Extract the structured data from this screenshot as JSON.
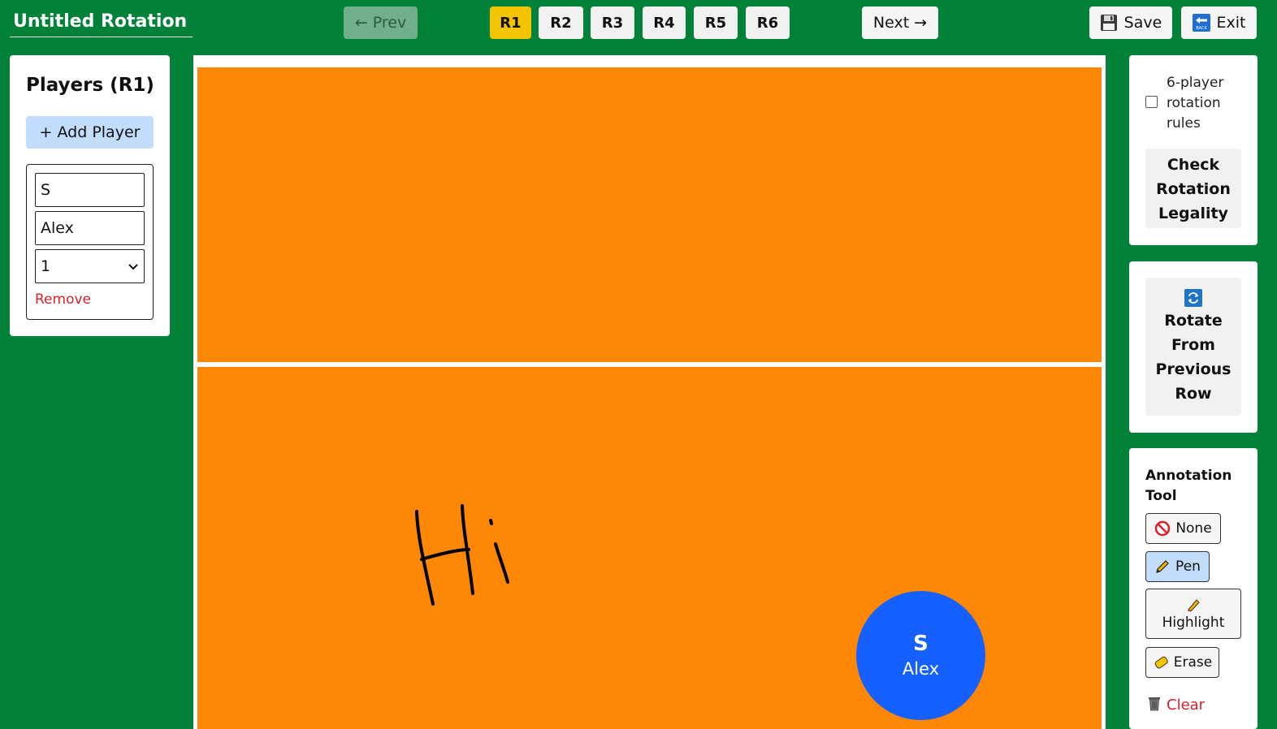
{
  "header": {
    "rotation_title": "Untitled Rotation",
    "prev_label": "← Prev",
    "next_label": "Next →",
    "rounds": [
      "R1",
      "R2",
      "R3",
      "R4",
      "R5",
      "R6"
    ],
    "active_round": "R1",
    "save_label": "Save",
    "exit_label": "Exit",
    "save_icon": "floppy-disk-icon",
    "exit_icon": "back-arrow-icon"
  },
  "players_panel": {
    "title": "Players (R1)",
    "add_player_label": "+ Add Player",
    "players": [
      {
        "position_value": "S",
        "name_value": "Alex",
        "number_selected": "1",
        "remove_label": "Remove"
      }
    ]
  },
  "court": {
    "annotation_text_drawn": "Hi",
    "token": {
      "position": "S",
      "name": "Alex"
    },
    "colors": {
      "court": "#fe8805",
      "token": "#1560fe",
      "background": "#028238"
    }
  },
  "right_panel": {
    "rules_label": "6-player rotation rules",
    "rules_checked": false,
    "check_label": "Check Rotation Legality",
    "rotate_label": "Rotate From Previous Row",
    "annotation_title": "Annotation Tool",
    "tools": [
      {
        "label": "None",
        "icon": "prohibited-icon"
      },
      {
        "label": "Pen",
        "icon": "pencil-icon",
        "active": true
      },
      {
        "label": "Highlight",
        "icon": "highlighter-icon"
      },
      {
        "label": "Erase",
        "icon": "eraser-icon"
      }
    ],
    "clear_label": "Clear"
  }
}
